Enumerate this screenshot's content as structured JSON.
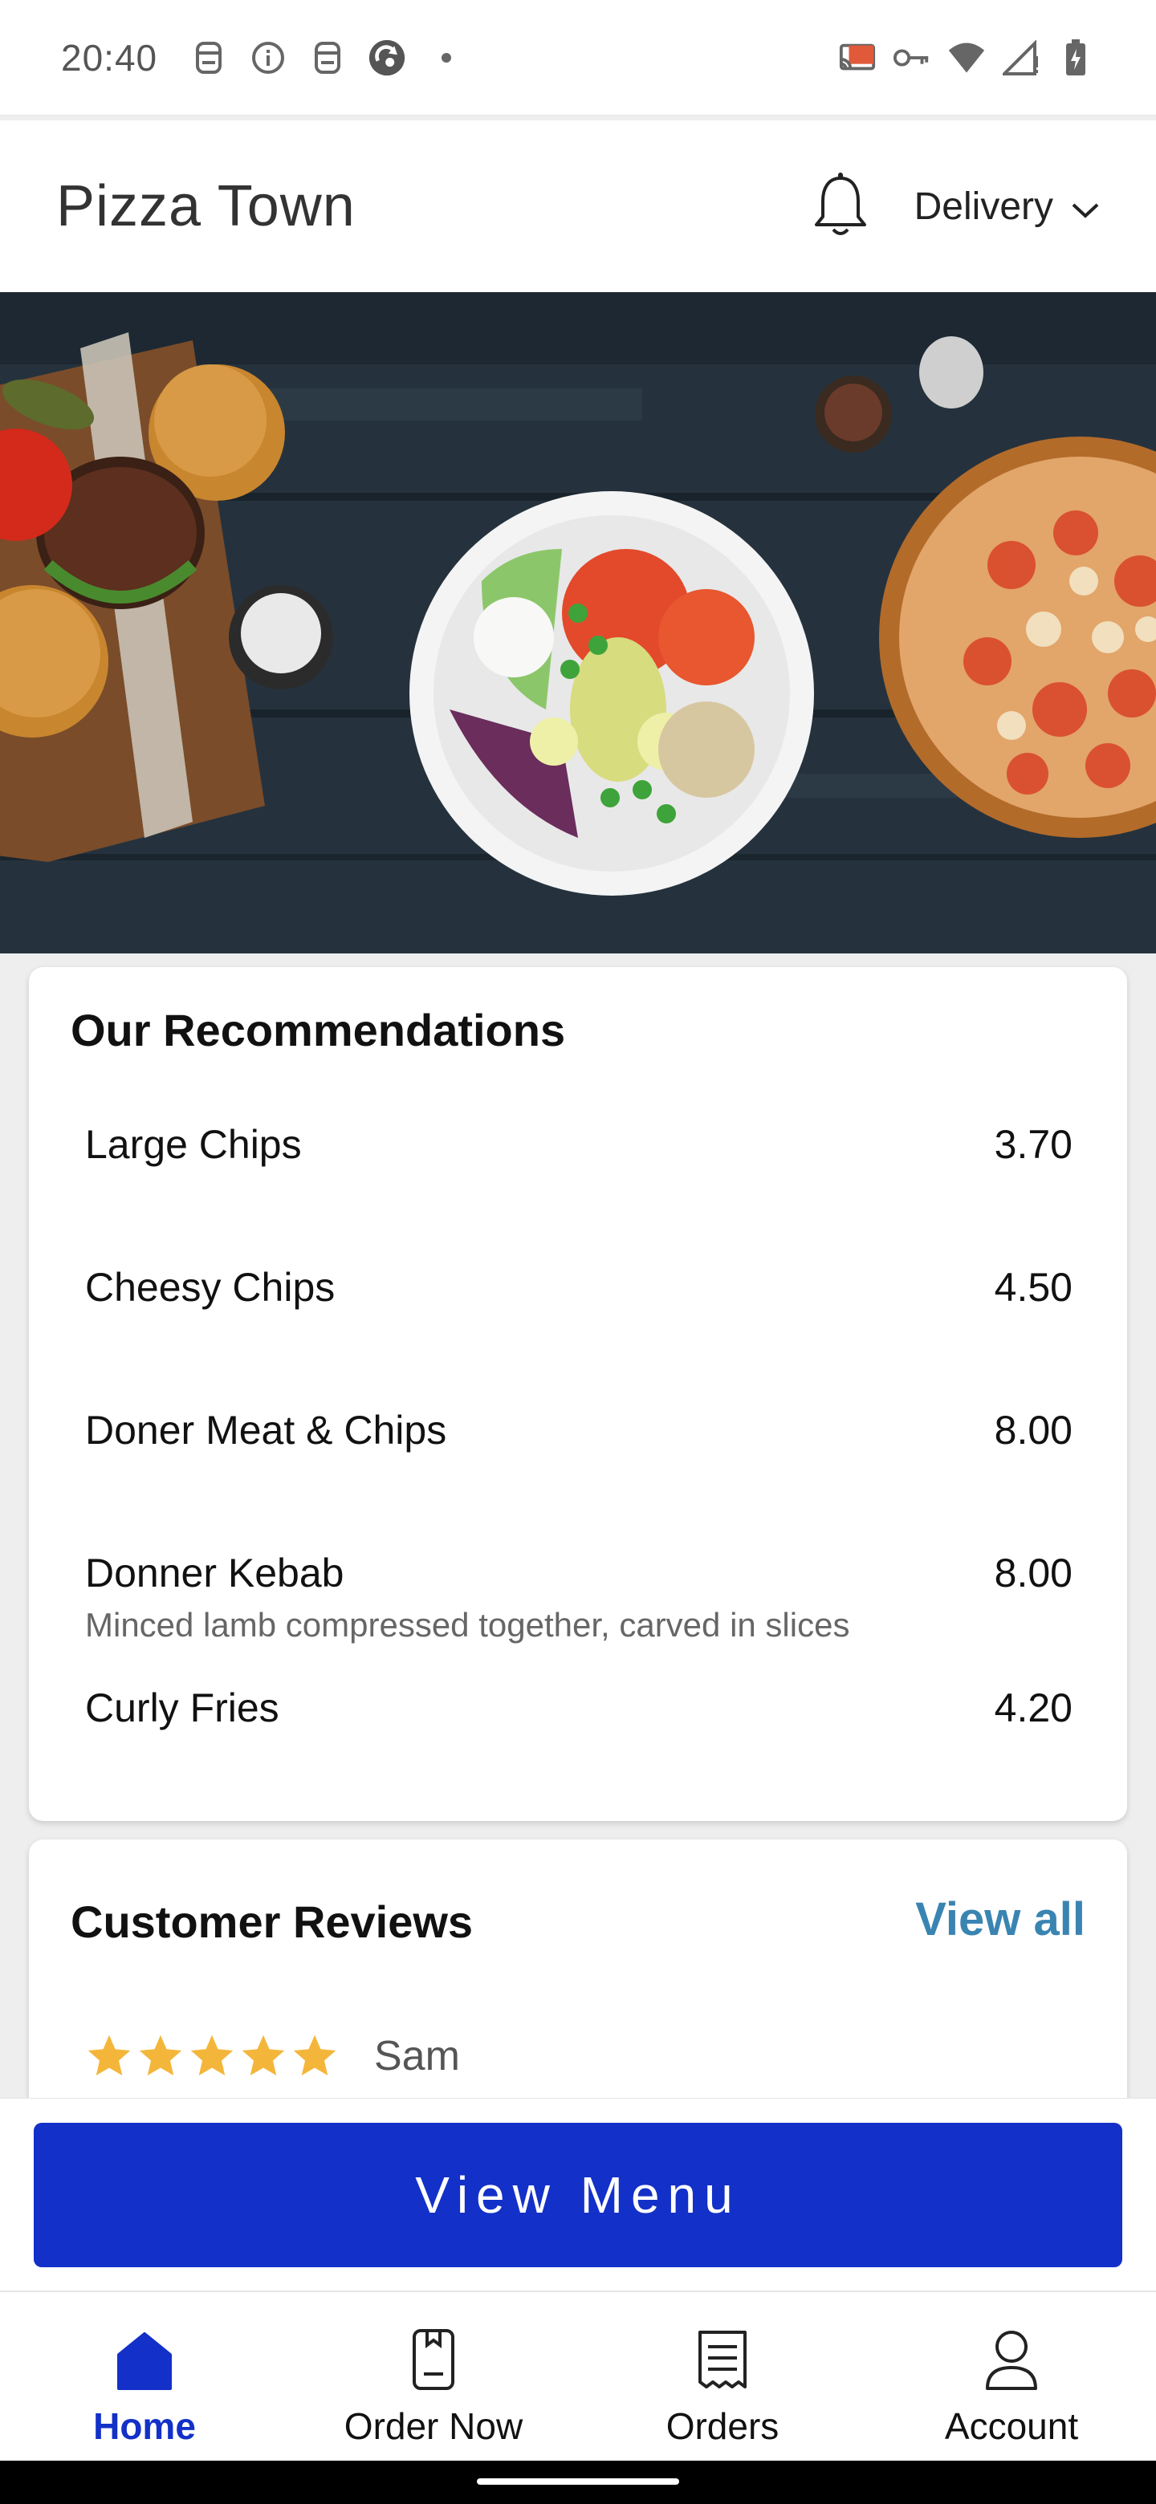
{
  "status_bar": {
    "time": "20:40",
    "left_icons": [
      "notification-icon",
      "info-icon",
      "notification-icon",
      "sync-app-icon",
      "dot-icon"
    ],
    "right_icons": [
      "cast-icon",
      "vpn-key-icon",
      "wifi-icon",
      "signal-icon",
      "battery-icon"
    ]
  },
  "header": {
    "title": "Pizza Town",
    "bell_icon": "bell-icon",
    "delivery_label": "Delivery"
  },
  "hero": {
    "description_icon": "food-hero-image"
  },
  "recommendations": {
    "title": "Our Recommendations",
    "items": [
      {
        "name": "Large Chips",
        "price": "3.70",
        "description": ""
      },
      {
        "name": "Cheesy Chips",
        "price": "4.50",
        "description": ""
      },
      {
        "name": "Doner Meat & Chips",
        "price": "8.00",
        "description": ""
      },
      {
        "name": "Donner Kebab",
        "price": "8.00",
        "description": "Minced lamb compressed together, carved in slices"
      },
      {
        "name": "Curly Fries",
        "price": "4.20",
        "description": ""
      }
    ]
  },
  "reviews": {
    "title": "Customer Reviews",
    "view_all": "View all",
    "items": [
      {
        "reviewer": "Sam",
        "rating": 5
      }
    ]
  },
  "view_menu_label": "View Menu",
  "bottom_nav": {
    "items": [
      {
        "label": "Home",
        "icon": "home-icon",
        "active": true
      },
      {
        "label": "Order Now",
        "icon": "order-now-icon",
        "active": false
      },
      {
        "label": "Orders",
        "icon": "receipt-icon",
        "active": false
      },
      {
        "label": "Account",
        "icon": "account-icon",
        "active": false
      }
    ]
  },
  "colors": {
    "accent": "#1330c8",
    "link": "#3a84b2",
    "star": "#f4b63a"
  }
}
